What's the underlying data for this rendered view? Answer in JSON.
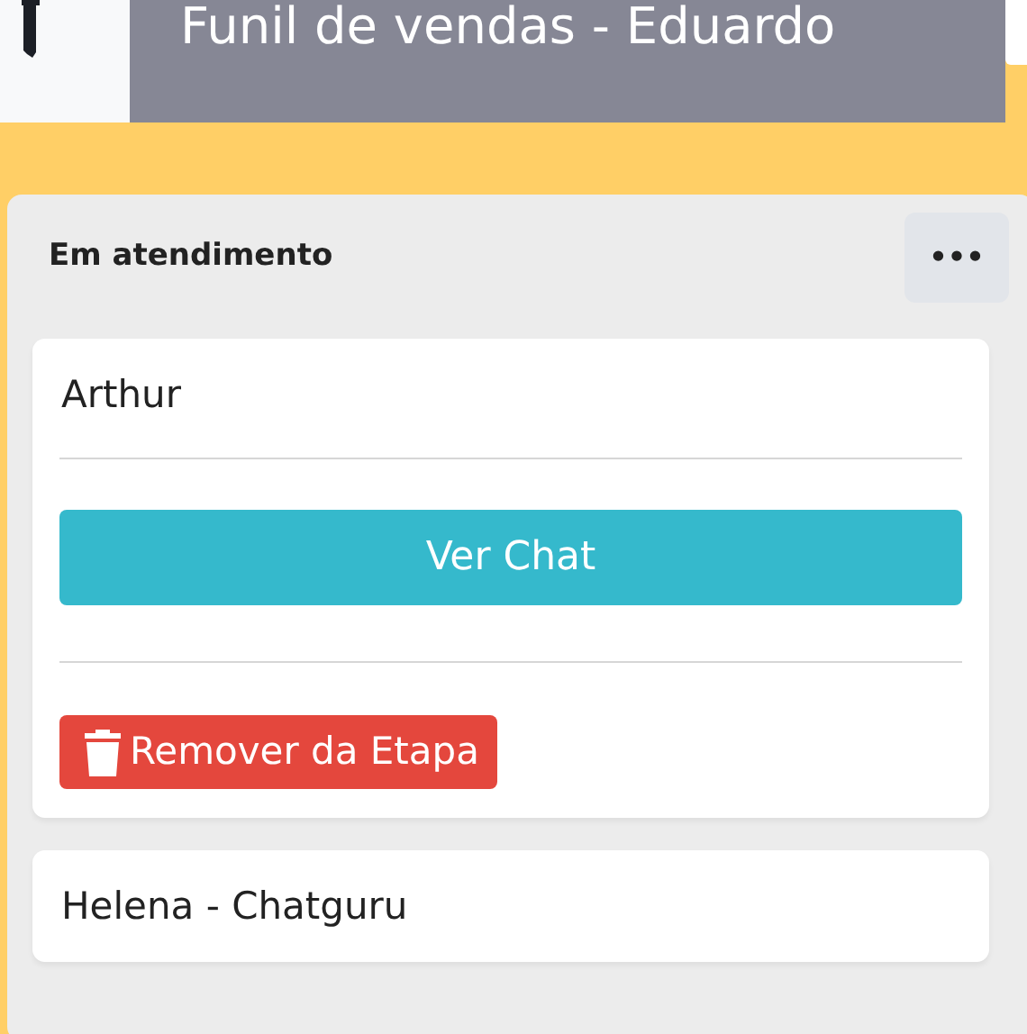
{
  "tab": {
    "title": "Funil de vendas - Eduardo"
  },
  "column": {
    "title": "Em atendimento",
    "menu": "•••",
    "cards": [
      {
        "name": "Arthur",
        "expanded": true,
        "chat_button": "Ver Chat",
        "remove_button": "Remover da Etapa"
      },
      {
        "name": "Helena - Chatguru",
        "expanded": false
      }
    ]
  }
}
